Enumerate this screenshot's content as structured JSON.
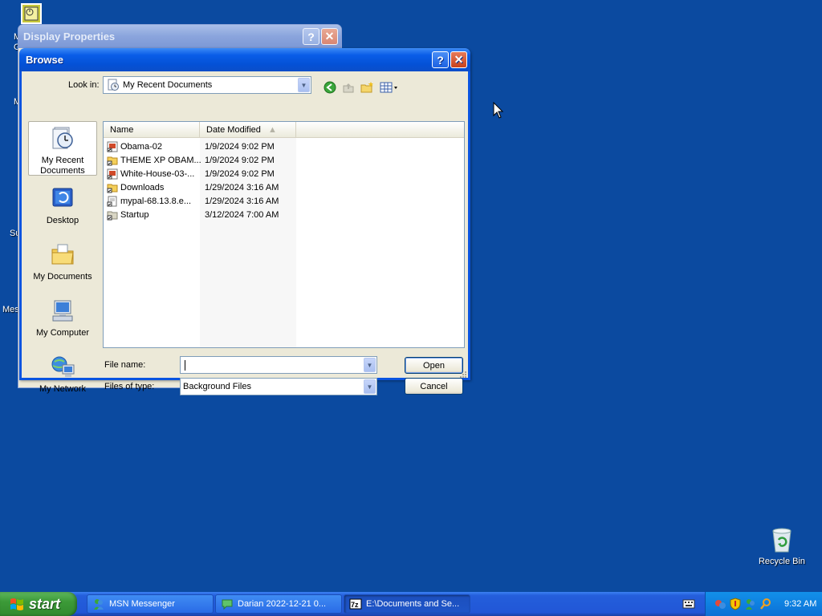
{
  "desktop": {
    "partial_labels": [
      "M",
      "G",
      "M",
      "Su",
      "Mes"
    ],
    "recycle_bin_label": "Recycle Bin"
  },
  "display_properties": {
    "title": "Display Properties",
    "help_label": "?",
    "close_label": "✕"
  },
  "browse": {
    "title": "Browse",
    "help_label": "?",
    "close_label": "✕",
    "look_in_label": "Look in:",
    "look_in_value": "My Recent Documents",
    "places": [
      {
        "label": "My Recent Documents",
        "icon": "recent-documents-icon"
      },
      {
        "label": "Desktop",
        "icon": "desktop-icon"
      },
      {
        "label": "My Documents",
        "icon": "my-documents-icon"
      },
      {
        "label": "My Computer",
        "icon": "my-computer-icon"
      },
      {
        "label": "My Network",
        "icon": "my-network-icon"
      }
    ],
    "columns": {
      "name": "Name",
      "date_modified": "Date Modified"
    },
    "files": [
      {
        "name": "Obama-02",
        "date": "1/9/2024 9:02 PM",
        "icon": "image-shortcut-icon"
      },
      {
        "name": "THEME XP OBAM...",
        "date": "1/9/2024 9:02 PM",
        "icon": "folder-shortcut-icon"
      },
      {
        "name": "White-House-03-...",
        "date": "1/9/2024 9:02 PM",
        "icon": "image-shortcut-icon"
      },
      {
        "name": "Downloads",
        "date": "1/29/2024 3:16 AM",
        "icon": "folder-shortcut-icon"
      },
      {
        "name": "mypal-68.13.8.e...",
        "date": "1/29/2024 3:16 AM",
        "icon": "file-shortcut-icon"
      },
      {
        "name": "Startup",
        "date": "3/12/2024 7:00 AM",
        "icon": "folder-shortcut-icon"
      }
    ],
    "file_name_label": "File name:",
    "file_name_value": "",
    "files_of_type_label": "Files of type:",
    "files_of_type_value": "Background Files",
    "open_label": "Open",
    "cancel_label": "Cancel"
  },
  "taskbar": {
    "start_label": "start",
    "tasks": [
      {
        "label": "MSN Messenger",
        "icon": "msn-messenger-icon",
        "active": false
      },
      {
        "label": "Darian 2022-12-21 0...",
        "icon": "messenger-chat-icon",
        "active": false
      },
      {
        "label": "E:\\Documents and Se...",
        "icon": "7zip-icon",
        "active": true
      }
    ],
    "clock": "9:32 AM"
  },
  "colors": {
    "desktop": "#0b4aa0",
    "xp_blue": "#0a54e0",
    "start_green": "#3c9a38",
    "dialog_face": "#ece9d8"
  }
}
